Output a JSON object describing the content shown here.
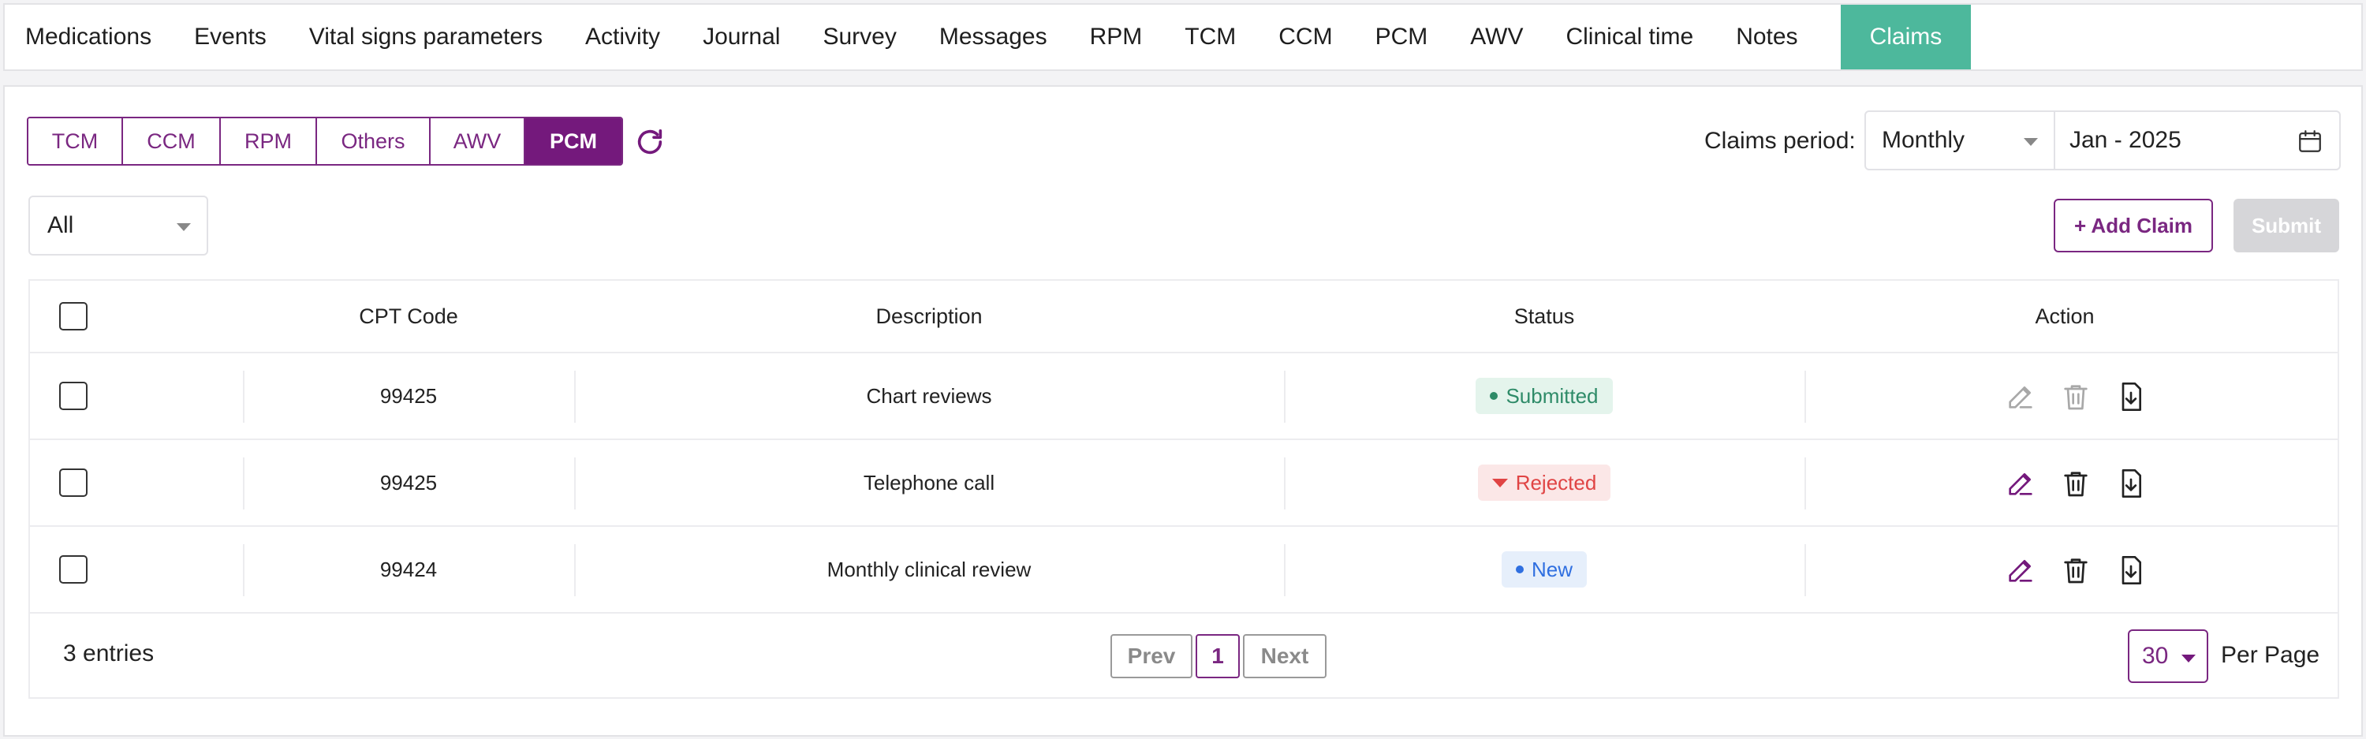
{
  "nav": {
    "items": [
      {
        "label": "Medications"
      },
      {
        "label": "Events"
      },
      {
        "label": "Vital signs parameters"
      },
      {
        "label": "Activity"
      },
      {
        "label": "Journal"
      },
      {
        "label": "Survey"
      },
      {
        "label": "Messages"
      },
      {
        "label": "RPM"
      },
      {
        "label": "TCM"
      },
      {
        "label": "CCM"
      },
      {
        "label": "PCM"
      },
      {
        "label": "AWV"
      },
      {
        "label": "Clinical time"
      },
      {
        "label": "Notes"
      },
      {
        "label": "Claims"
      }
    ],
    "active": "Claims"
  },
  "program_tabs": {
    "items": [
      {
        "label": "TCM"
      },
      {
        "label": "CCM"
      },
      {
        "label": "RPM"
      },
      {
        "label": "Others"
      },
      {
        "label": "AWV"
      },
      {
        "label": "PCM"
      }
    ],
    "active": "PCM"
  },
  "claims_period": {
    "label": "Claims period:",
    "type_value": "Monthly",
    "date_value": "Jan - 2025"
  },
  "filter": {
    "value": "All"
  },
  "buttons": {
    "add_claim": "+ Add Claim",
    "submit": "Submit"
  },
  "table": {
    "headers": {
      "cpt": "CPT Code",
      "description": "Description",
      "status": "Status",
      "action": "Action"
    },
    "rows": [
      {
        "cpt": "99425",
        "description": "Chart reviews",
        "status": "Submitted"
      },
      {
        "cpt": "99425",
        "description": "Telephone call",
        "status": "Rejected"
      },
      {
        "cpt": "99424",
        "description": "Monthly clinical review",
        "status": "New"
      }
    ]
  },
  "footer": {
    "entries": "3 entries",
    "prev": "Prev",
    "page": "1",
    "next": "Next",
    "per_page_value": "30",
    "per_page_label": "Per Page"
  },
  "colors": {
    "brand": "#74197c",
    "active_tab": "#4db89c",
    "submitted": "#2e8b68",
    "rejected": "#e04444",
    "new": "#2f6fe0"
  }
}
